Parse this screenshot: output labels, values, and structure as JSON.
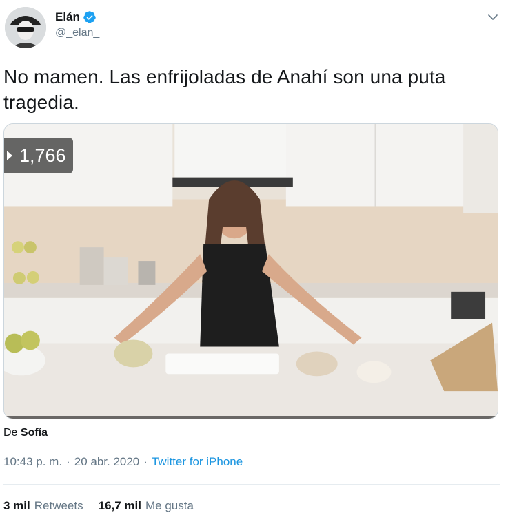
{
  "author": {
    "name": "Elán",
    "handle": "@_elan_",
    "verified": true,
    "avatar_icon": "avatar-photo"
  },
  "tweet": {
    "text": "No mamen. Las enfrijoladas de Anahí son una puta tragedia."
  },
  "media": {
    "type": "video",
    "view_count": "1,766",
    "views_icon": "play-count-icon"
  },
  "attribution": {
    "prefix": "De",
    "name": "Sofía"
  },
  "meta": {
    "time": "10:43 p. m.",
    "separator": "·",
    "date": "20 abr. 2020",
    "source": "Twitter for iPhone"
  },
  "stats": {
    "retweets_count": "3 mil",
    "retweets_label": "Retweets",
    "likes_count": "16,7 mil",
    "likes_label": "Me gusta"
  },
  "colors": {
    "link": "#1b95e0",
    "verified": "#1da1f2",
    "secondary_text": "#657786",
    "divider": "#e6ecf0"
  }
}
